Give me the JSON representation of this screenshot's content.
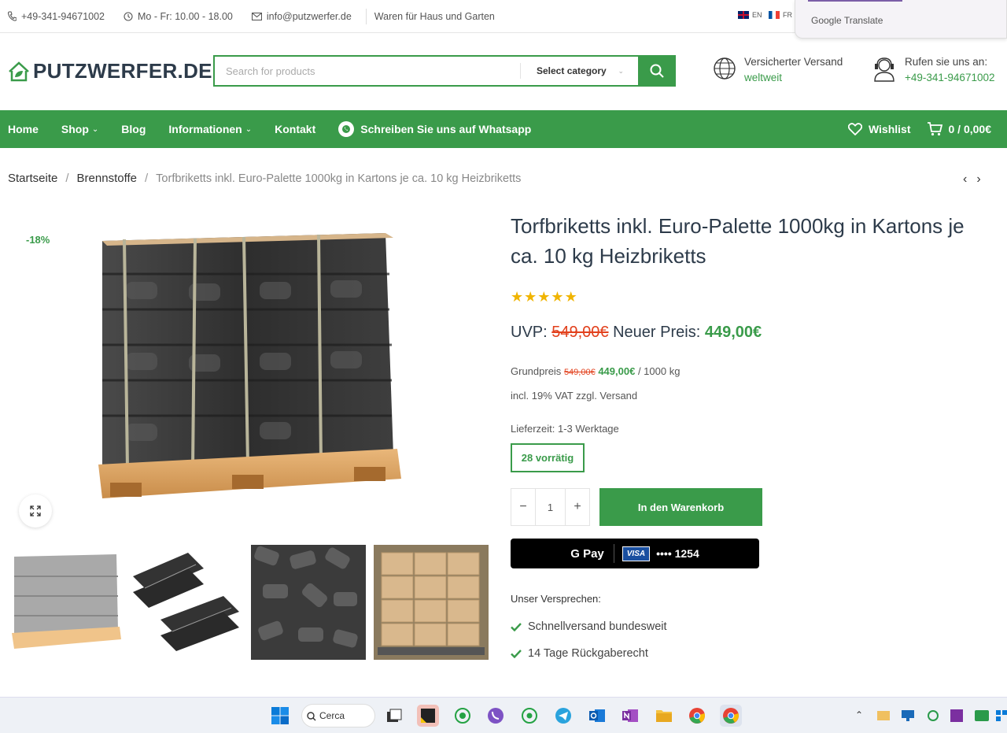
{
  "topbar": {
    "phone": "+49-341-94671002",
    "hours": "Mo - Fr: 10.00 - 18.00",
    "email": "info@putzwerfer.de",
    "tagline": "Waren für Haus und Garten",
    "lang_en": "EN",
    "lang_fr": "FR"
  },
  "google_translate": {
    "label": "Google Translate"
  },
  "header": {
    "logo": "PUTZWERFER.DE",
    "search_placeholder": "Search for products",
    "category_label": "Select category",
    "shipping_title": "Versicherter Versand",
    "shipping_sub": "weltweit",
    "call_title": "Rufen sie uns an:",
    "call_number": "+49-341-94671002"
  },
  "nav": {
    "items": [
      "Home",
      "Shop",
      "Blog",
      "Informationen",
      "Kontakt"
    ],
    "whatsapp": "Schreiben Sie uns auf Whatsapp",
    "wishlist": "Wishlist",
    "cart": "0 / 0,00€"
  },
  "breadcrumb": {
    "home": "Startseite",
    "category": "Brennstoffe",
    "current": "Torfbriketts inkl. Euro-Palette 1000kg in Kartons je ca. 10 kg Heizbriketts"
  },
  "product": {
    "badge": "-18%",
    "title": "Torfbriketts inkl. Euro-Palette 1000kg in Kartons je ca. 10 kg Heizbriketts",
    "rating": 5,
    "uvp_label": "UVP:",
    "old_price": "549,00€",
    "new_price_label": "Neuer Preis:",
    "new_price": "449,00€",
    "grund_label": "Grundpreis",
    "grund_old": "549,00€",
    "grund_new": "449,00€",
    "grund_unit": "/ 1000 kg",
    "vat": "incl. 19% VAT zzgl. Versand",
    "delivery": "Lieferzeit: 1-3 Werktage",
    "stock": "28 vorrätig",
    "qty": "1",
    "qty_minus": "−",
    "qty_plus": "+",
    "add_to_cart": "In den Warenkorb",
    "gpay_label": "G Pay",
    "card_brand": "VISA",
    "card_number": "•••• 1254",
    "promise_title": "Unser Versprechen:",
    "promises": [
      "Schnellversand bundesweit",
      "14 Tage Rückgaberecht"
    ]
  },
  "taskbar": {
    "search": "Cerca"
  },
  "colors": {
    "accent": "#3a9b4a",
    "sale": "#e2401c",
    "star": "#f0b400",
    "title": "#2d3b4a"
  }
}
